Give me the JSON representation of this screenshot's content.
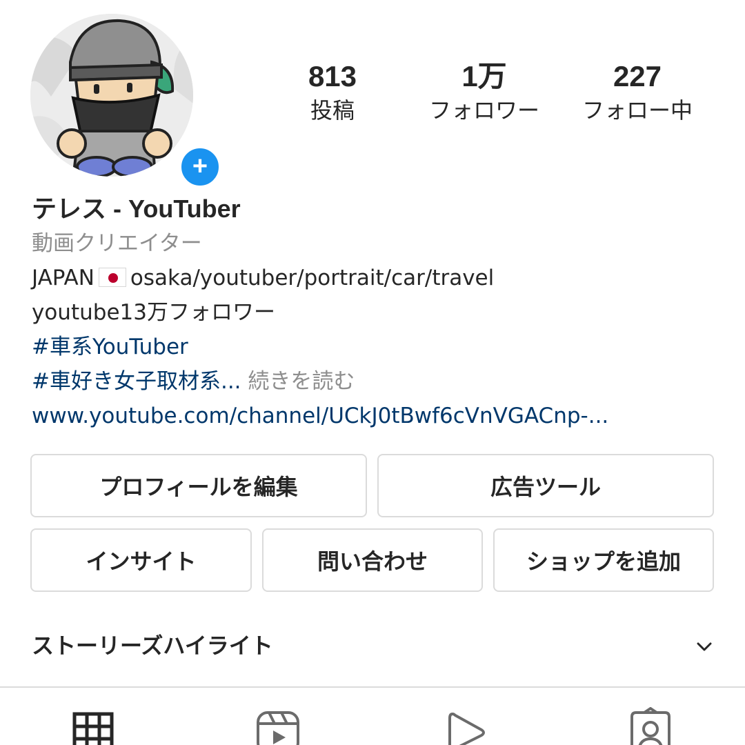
{
  "profile": {
    "add_badge": "+",
    "stats": [
      {
        "value": "813",
        "label": "投稿"
      },
      {
        "value": "1万",
        "label": "フォロワー"
      },
      {
        "value": "227",
        "label": "フォロー中"
      }
    ],
    "name": "テレス - YouTuber",
    "category": "動画クリエイター",
    "bio_line1_prefix": "JAPAN",
    "bio_line1_flag_icon": "japan-flag-icon",
    "bio_line1_suffix": "osaka/youtuber/portrait/car/travel",
    "bio_line2": "youtube13万フォロワー",
    "hashtag1": "#車系YouTuber",
    "hashtag2": "#車好き女子取材系...",
    "more_label": " 続きを読む",
    "link": "www.youtube.com/channel/UCkJ0tBwf6cVnVGACnp-..."
  },
  "buttons": {
    "edit_profile": "プロフィールを編集",
    "ad_tools": "広告ツール",
    "insights": "インサイト",
    "contact": "問い合わせ",
    "add_shop": "ショップを追加"
  },
  "highlights": {
    "title": "ストーリーズハイライト",
    "icon": "chevron-down-icon"
  },
  "tabs": [
    {
      "icon": "grid-icon",
      "active": true
    },
    {
      "icon": "reels-icon",
      "active": false
    },
    {
      "icon": "video-play-icon",
      "active": false
    },
    {
      "icon": "tagged-user-icon",
      "active": false
    }
  ],
  "colors": {
    "accent_blue": "#1a93f0",
    "link_blue": "#00376b",
    "secondary_text": "#8e8e8e",
    "border": "#dbdbdb"
  }
}
